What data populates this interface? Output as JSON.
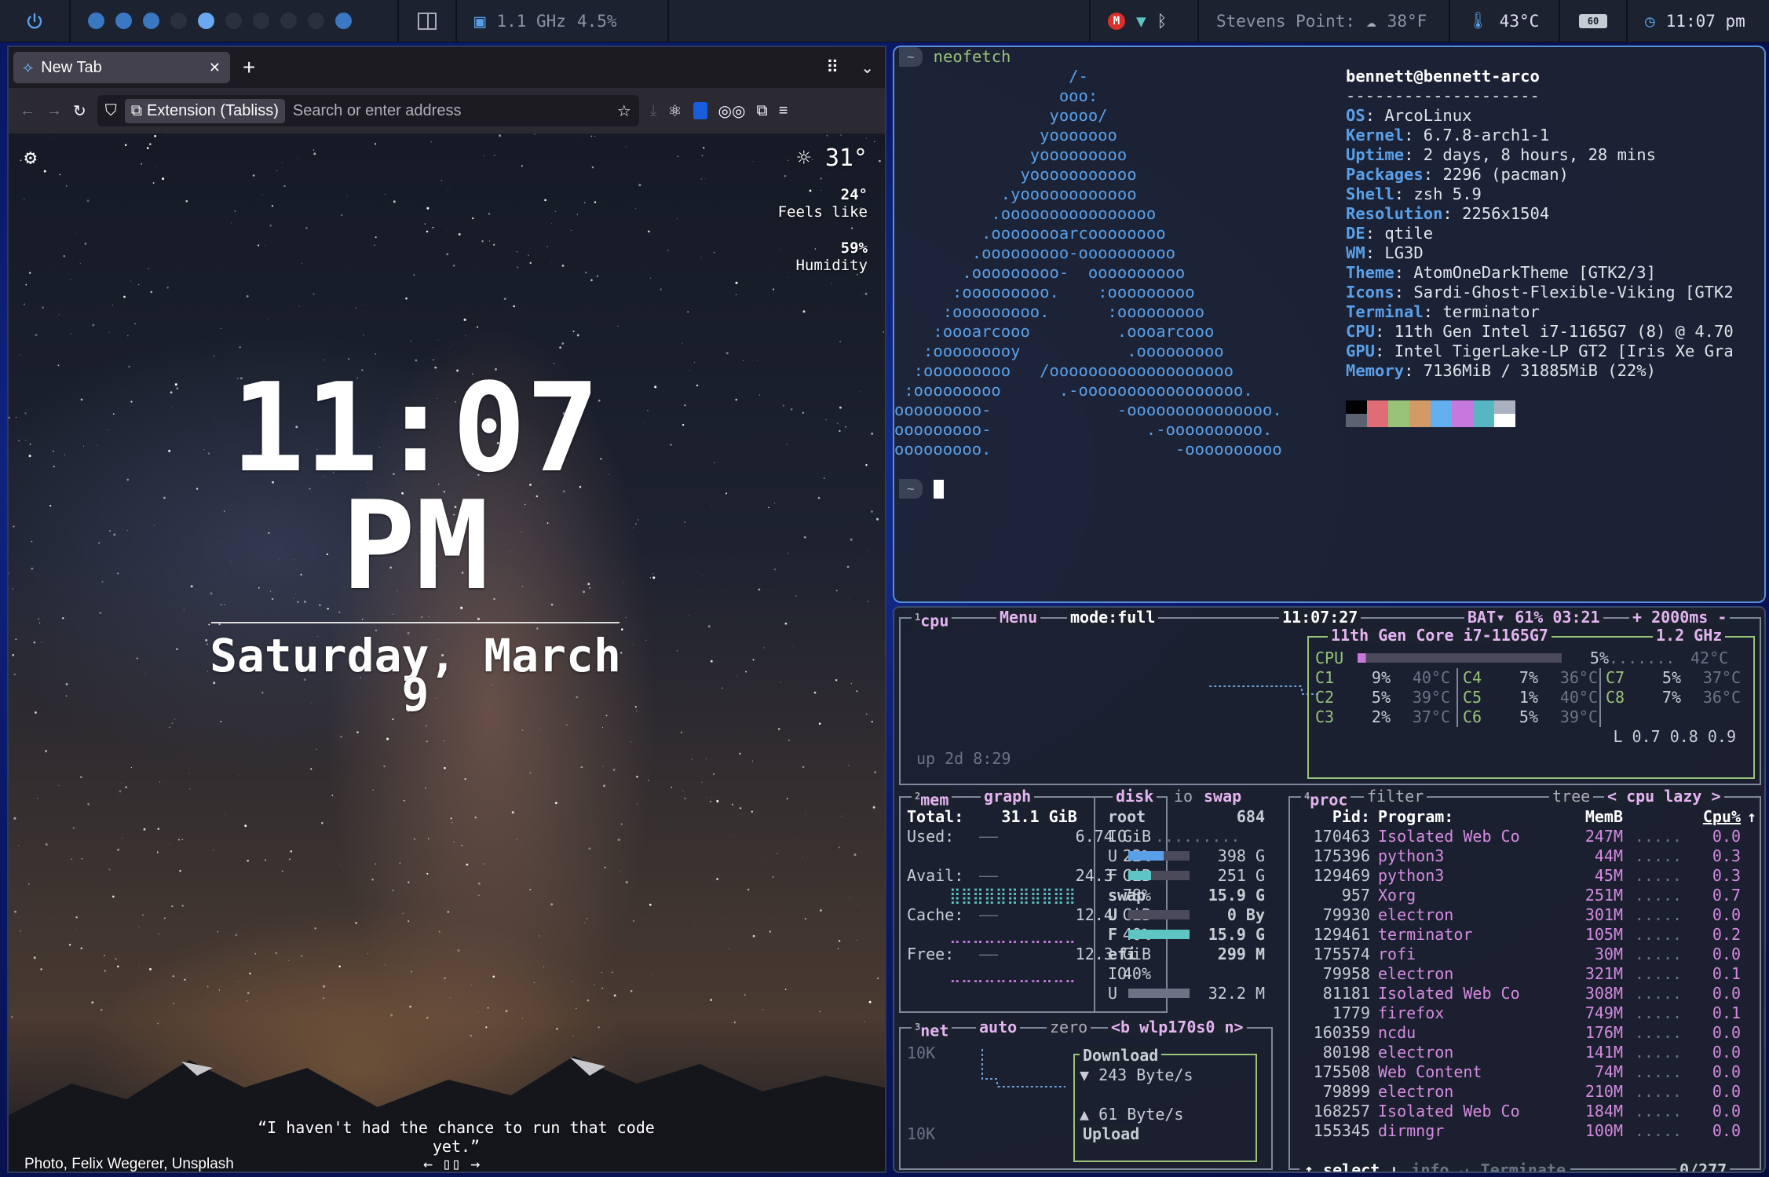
{
  "topbar": {
    "cpu_freq": "1.1 GHz",
    "cpu_pct": "4.5%",
    "location_label": "Stevens Point:",
    "weather_temp": "38°F",
    "cpu_temp": "43°C",
    "battery_badge": "60",
    "clock": "11:07 pm",
    "workspaces": [
      "on",
      "on",
      "on",
      "off",
      "active",
      "off",
      "off",
      "off",
      "off",
      "on"
    ]
  },
  "browser": {
    "tab_title": "New Tab",
    "new_tab": "+",
    "ext_chip": "Extension (Tabliss)",
    "url_placeholder": "Search or enter address",
    "weather": {
      "temp": "31°",
      "feels_value": "24°",
      "feels_label": "Feels like",
      "humidity_value": "59%",
      "humidity_label": "Humidity"
    },
    "clock_time": "11:07",
    "clock_ampm": "PM",
    "date": "Saturday, March 9",
    "quote": "“I haven't had the chance to run that code yet.”",
    "credit": "Photo, Felix Wegerer, Unsplash"
  },
  "terminal": {
    "prompt_symbol": "~",
    "command": "neofetch",
    "logo": [
      "                  /-",
      "                 ooo:",
      "                yoooo/",
      "               yooooooo",
      "              yooooooooo",
      "             yooooooooooo",
      "           .yoooooooooooo",
      "          .oooooooooooooooo",
      "         .oooooooarcoooooooo",
      "        .ooooooooo-oooooooooo",
      "       .ooooooooo-  oooooooooo",
      "      :ooooooooo.    :ooooooooo",
      "     :ooooooooo.      :ooooooooo",
      "    :oooarcooo         .oooarcooo",
      "   :ooooooooy           .ooooooooo",
      "  :ooooooooo   /ooooooooooooooooooo",
      " :ooooooooo      .-ooooooooooooooooo.",
      "ooooooooo-             -ooooooooooooooo.",
      "ooooooooo-                .-oooooooooo.",
      "ooooooooo.                   -oooooooooo"
    ],
    "userhost": "bennett@bennett-arco",
    "separator": "--------------------",
    "info": [
      {
        "k": "OS",
        "v": "ArcoLinux"
      },
      {
        "k": "Kernel",
        "v": "6.7.8-arch1-1"
      },
      {
        "k": "Uptime",
        "v": "2 days, 8 hours, 28 mins"
      },
      {
        "k": "Packages",
        "v": "2296 (pacman)"
      },
      {
        "k": "Shell",
        "v": "zsh 5.9"
      },
      {
        "k": "Resolution",
        "v": "2256x1504"
      },
      {
        "k": "DE",
        "v": "qtile"
      },
      {
        "k": "WM",
        "v": "LG3D"
      },
      {
        "k": "Theme",
        "v": "AtomOneDarkTheme [GTK2/3]"
      },
      {
        "k": "Icons",
        "v": "Sardi-Ghost-Flexible-Viking [GTK2"
      },
      {
        "k": "Terminal",
        "v": "terminator"
      },
      {
        "k": "CPU",
        "v": "11th Gen Intel i7-1165G7 (8) @ 4.70"
      },
      {
        "k": "GPU",
        "v": "Intel TigerLake-LP GT2 [Iris Xe Gra"
      },
      {
        "k": "Memory",
        "v": "7136MiB / 31885MiB (22%)"
      }
    ],
    "palette_top": [
      "#000000",
      "#e06c75",
      "#98c379",
      "#d19a66",
      "#61afef",
      "#c678dd",
      "#56b6c2",
      "#abb2bf"
    ],
    "palette_bottom": [
      "#5c6370",
      "#e06c75",
      "#98c379",
      "#d19a66",
      "#61afef",
      "#c678dd",
      "#56b6c2",
      "#ffffff"
    ]
  },
  "btop": {
    "cpu": {
      "num": "1",
      "title": "cpu",
      "menu": "Menu",
      "mode": "mode:full",
      "time": "11:07:27",
      "bat": "BAT▾ 61% 03:21",
      "rate": "+ 2000ms -",
      "model": "11th Gen Core i7-1165G7",
      "freq": "1.2 GHz",
      "total_label": "CPU",
      "total_pct": "5%",
      "total_temp": "42°C",
      "cores": [
        {
          "n": "C1",
          "p": "9%",
          "t": "40°C"
        },
        {
          "n": "C4",
          "p": "7%",
          "t": "36°C"
        },
        {
          "n": "C7",
          "p": "5%",
          "t": "37°C"
        },
        {
          "n": "C2",
          "p": "5%",
          "t": "39°C"
        },
        {
          "n": "C5",
          "p": "1%",
          "t": "40°C"
        },
        {
          "n": "C8",
          "p": "7%",
          "t": "36°C"
        },
        {
          "n": "C3",
          "p": "2%",
          "t": "37°C"
        },
        {
          "n": "C6",
          "p": "5%",
          "t": "39°C"
        }
      ],
      "load": "L 0.7 0.8 0.9",
      "uptime": "up 2d 8:29"
    },
    "mem": {
      "num": "2",
      "title": "mem",
      "graph": "graph",
      "total": "Total:    31.1 GiB",
      "used": "Used:",
      "used_v": "6.74 GiB",
      "used_p": "22%",
      "avail": "Avail:",
      "avail_v": "24.3 GiB",
      "avail_p": "78%",
      "cache": "Cache:",
      "cache_v": "12.4 GiB",
      "cache_p": "40%",
      "free": "Free:",
      "free_v": "12.3 GiB",
      "free_p": "40%"
    },
    "disk": {
      "title": "disk",
      "io": "io",
      "swap": "swap",
      "root": "root",
      "root_size": "684",
      "io_label": "IO",
      "u": "U",
      "u_v": "398 G",
      "f": "F",
      "f_v": "251 G",
      "swap_label": "swap",
      "swap_size": "15.9 G",
      "swap_u": "0 By",
      "swap_f": "15.9 G",
      "efi": "efi",
      "efi_size": "299 M",
      "efi_u": "32.2 M"
    },
    "net": {
      "num": "3",
      "title": "net",
      "auto": "auto",
      "zero": "zero",
      "iface": "<b wlp170s0 n>",
      "scale_top": "10K",
      "scale_bot": "10K",
      "download": "Download",
      "down_rate": "▼ 243 Byte/s",
      "up_rate": "▲ 61 Byte/s",
      "upload": "Upload"
    },
    "proc": {
      "num": "4",
      "title": "proc",
      "filter": "filter",
      "tree": "tree",
      "sort": "< cpu lazy >",
      "h_pid": "Pid:",
      "h_prog": "Program:",
      "h_mem": "MemB",
      "h_cpu": "Cpu%",
      "rows": [
        {
          "pid": "170463",
          "prog": "Isolated Web Co",
          "mem": "247M",
          "cpu": "0.0"
        },
        {
          "pid": "175396",
          "prog": "python3",
          "mem": "44M",
          "cpu": "0.3"
        },
        {
          "pid": "129469",
          "prog": "python3",
          "mem": "45M",
          "cpu": "0.3"
        },
        {
          "pid": "957",
          "prog": "Xorg",
          "mem": "251M",
          "cpu": "0.7"
        },
        {
          "pid": "79930",
          "prog": "electron",
          "mem": "301M",
          "cpu": "0.0"
        },
        {
          "pid": "129461",
          "prog": "terminator",
          "mem": "105M",
          "cpu": "0.2"
        },
        {
          "pid": "175574",
          "prog": "rofi",
          "mem": "30M",
          "cpu": "0.0"
        },
        {
          "pid": "79958",
          "prog": "electron",
          "mem": "321M",
          "cpu": "0.1"
        },
        {
          "pid": "81181",
          "prog": "Isolated Web Co",
          "mem": "308M",
          "cpu": "0.0"
        },
        {
          "pid": "1779",
          "prog": "firefox",
          "mem": "749M",
          "cpu": "0.1"
        },
        {
          "pid": "160359",
          "prog": "ncdu",
          "mem": "176M",
          "cpu": "0.0"
        },
        {
          "pid": "80198",
          "prog": "electron",
          "mem": "141M",
          "cpu": "0.0"
        },
        {
          "pid": "175508",
          "prog": "Web Content",
          "mem": "74M",
          "cpu": "0.0"
        },
        {
          "pid": "79899",
          "prog": "electron",
          "mem": "210M",
          "cpu": "0.0"
        },
        {
          "pid": "168257",
          "prog": "Isolated Web Co",
          "mem": "184M",
          "cpu": "0.0"
        },
        {
          "pid": "155345",
          "prog": "dirmngr",
          "mem": "100M",
          "cpu": "0.0"
        }
      ],
      "f_select": "↑ select ↓",
      "f_info": "info ↵",
      "f_term": "Terminate",
      "f_count": "0/277"
    }
  }
}
